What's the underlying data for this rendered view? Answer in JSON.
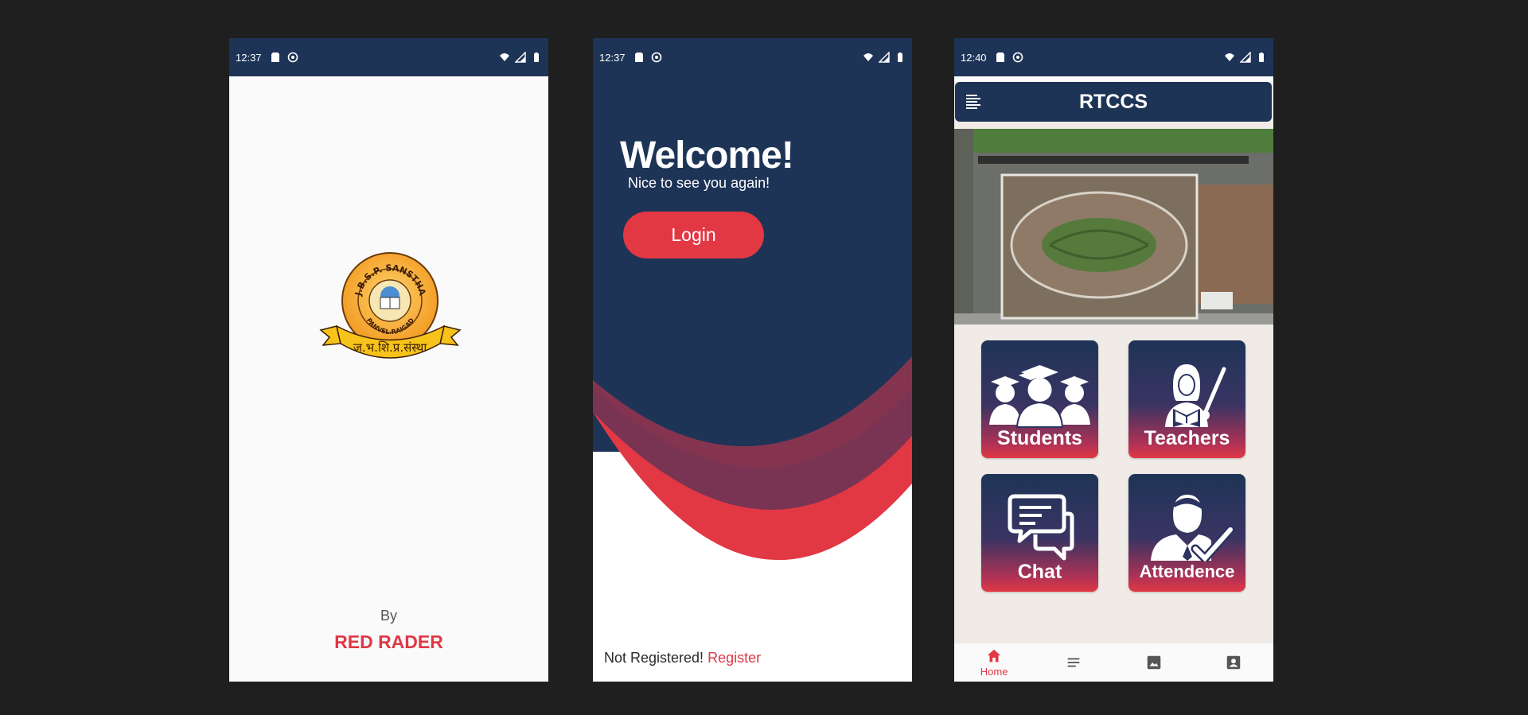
{
  "screens": {
    "splash": {
      "status_time": "12:37",
      "logo_text": {
        "ring": "J.B.S.P. SANSTHA",
        "ring_bottom": "PANVEL.RAIGAD",
        "ribbon": "ज.भ.शि.प्र.संस्था"
      },
      "by_label": "By",
      "brand": "RED RADER"
    },
    "welcome": {
      "status_time": "12:37",
      "title": "Welcome!",
      "subtitle": "Nice to see you again!",
      "login_label": "Login",
      "not_registered": "Not Registered!",
      "register_label": "Register"
    },
    "home": {
      "status_time": "12:40",
      "app_title": "RTCCS",
      "tiles": [
        {
          "label": "Students",
          "icon": "students-icon"
        },
        {
          "label": "Teachers",
          "icon": "teacher-icon"
        },
        {
          "label": "Chat",
          "icon": "chat-icon"
        },
        {
          "label": "Attendence",
          "icon": "attendance-icon"
        }
      ],
      "bottom_nav": [
        {
          "label": "Home",
          "icon": "home-icon",
          "active": true
        },
        {
          "label": "",
          "icon": "list-icon",
          "active": false
        },
        {
          "label": "",
          "icon": "image-icon",
          "active": false
        },
        {
          "label": "",
          "icon": "contact-icon",
          "active": false
        }
      ]
    }
  },
  "colors": {
    "navy": "#1e3457",
    "red": "#e23844",
    "background": "#1f1f1f"
  }
}
